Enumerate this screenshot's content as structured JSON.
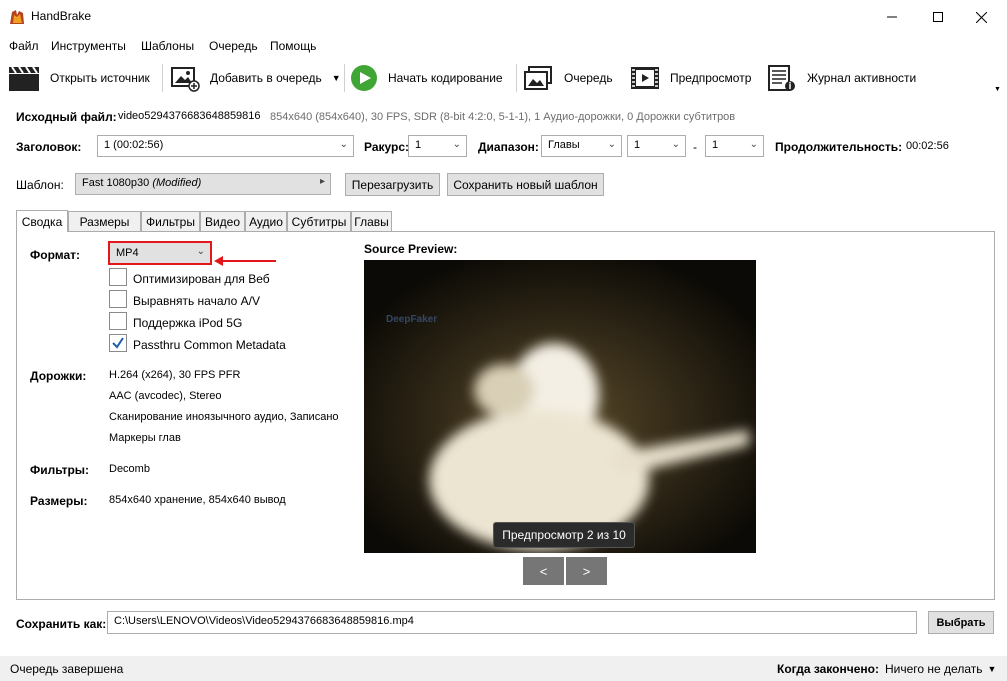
{
  "window": {
    "title": "HandBrake"
  },
  "menu": [
    "Файл",
    "Инструменты",
    "Шаблоны",
    "Очередь",
    "Помощь"
  ],
  "toolbar": {
    "open_source": "Открыть источник",
    "add_to_queue": "Добавить в очередь",
    "start_encode": "Начать кодирование",
    "queue": "Очередь",
    "preview": "Предпросмотр",
    "activity_log": "Журнал активности"
  },
  "source": {
    "label": "Исходный файл:",
    "filename": "video5294376683648859816",
    "info": "854x640 (854x640), 30 FPS, SDR (8-bit 4:2:0, 5-1-1), 1 Аудио-дорожки, 0 Дорожки субтитров"
  },
  "title_row": {
    "title_label": "Заголовок:",
    "title_value": "1  (00:02:56)",
    "angle_label": "Ракурс:",
    "angle_value": "1",
    "range_label": "Диапазон:",
    "range_type": "Главы",
    "range_from": "1",
    "range_dash": "-",
    "range_to": "1",
    "duration_label": "Продолжительность:",
    "duration_value": "00:02:56"
  },
  "preset": {
    "label": "Шаблон:",
    "name": "Fast 1080p30",
    "modified": "(Modified)",
    "reload": "Перезагрузить",
    "save_new": "Сохранить новый шаблон"
  },
  "tabs": [
    "Сводка",
    "Размеры",
    "Фильтры",
    "Видео",
    "Аудио",
    "Субтитры",
    "Главы"
  ],
  "summary": {
    "format_label": "Формат:",
    "format_value": "MP4",
    "options": [
      {
        "label": "Оптимизирован для Веб",
        "checked": false
      },
      {
        "label": "Выравнять начало A/V",
        "checked": false
      },
      {
        "label": "Поддержка iPod 5G",
        "checked": false
      },
      {
        "label": "Passthru Common Metadata",
        "checked": true
      }
    ],
    "tracks_label": "Дорожки:",
    "tracks": [
      "H.264 (x264), 30 FPS PFR",
      "AAC (avcodec), Stereo",
      "Сканирование иноязычного аудио, Записано",
      "Маркеры глав"
    ],
    "filters_label": "Фильтры:",
    "filters_value": "Decomb",
    "sizes_label": "Размеры:",
    "sizes_value": "854x640 хранение, 854x640 вывод"
  },
  "preview": {
    "title": "Source Preview:",
    "watermark": "DeepFaker",
    "badge": "Предпросмотр 2 из 10",
    "prev": "<",
    "next": ">"
  },
  "save": {
    "label": "Сохранить как:",
    "path": "C:\\Users\\LENOVO\\Videos\\Video5294376683648859816.mp4",
    "browse": "Выбрать"
  },
  "status": {
    "text": "Очередь завершена",
    "when_done_label": "Когда закончено:",
    "when_done_value": "Ничего не делать"
  },
  "colors": {
    "annotation": "#e3161c",
    "accent_check": "#1f5fa8",
    "play_green": "#3fa535"
  }
}
